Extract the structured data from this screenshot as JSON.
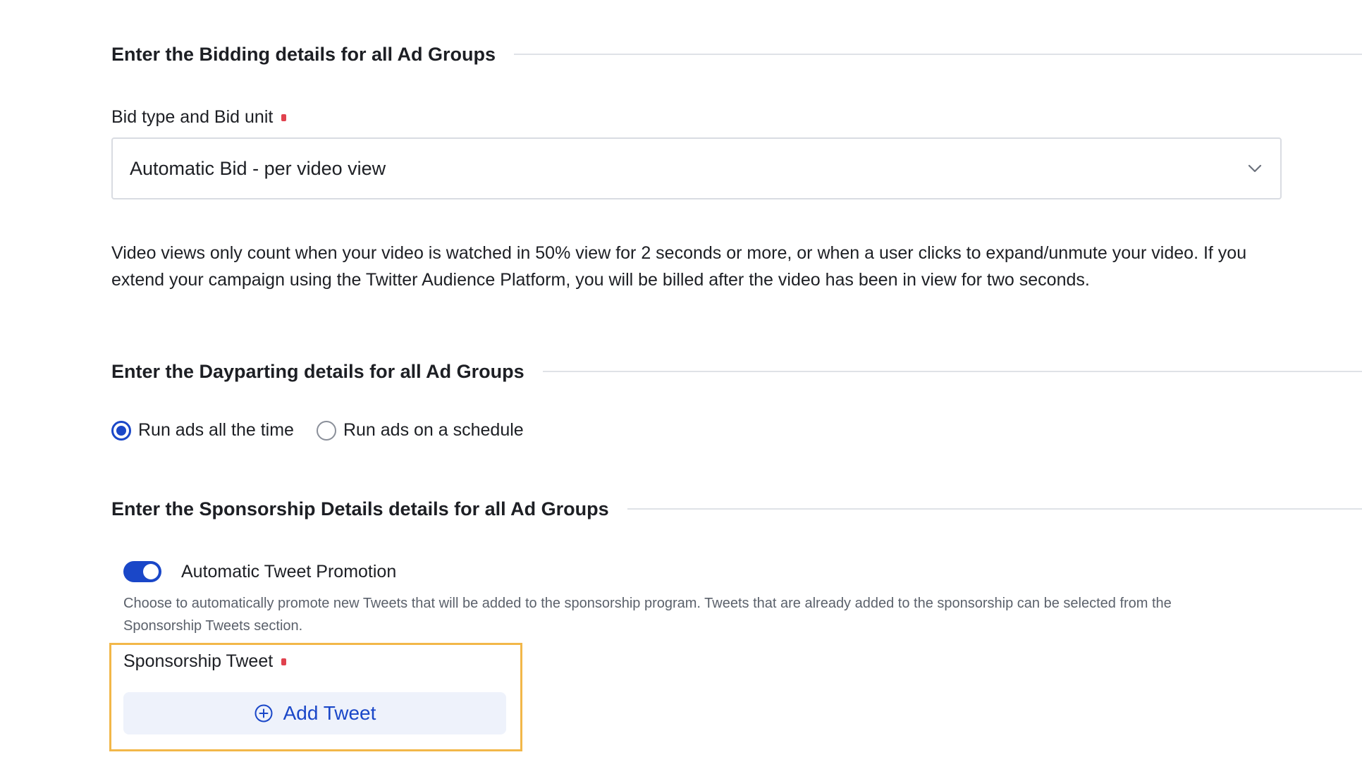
{
  "bidding": {
    "section_title": "Enter the Bidding details for all Ad Groups",
    "bid_label": "Bid type and Bid unit",
    "bid_value": "Automatic Bid - per video view",
    "help_text": "Video views only count when your video is watched in 50% view for 2 seconds or more, or when a user clicks to expand/unmute your video. If you extend your campaign using the Twitter Audience Platform, you will be billed after the video has been in view for two seconds."
  },
  "dayparting": {
    "section_title": "Enter the Dayparting details for all Ad Groups",
    "options": [
      {
        "label": "Run ads all the time",
        "selected": true
      },
      {
        "label": "Run ads on a schedule",
        "selected": false
      }
    ]
  },
  "sponsorship": {
    "section_title": "Enter the Sponsorship Details details for all Ad Groups",
    "toggle_label": "Automatic Tweet Promotion",
    "toggle_on": true,
    "toggle_description": "Choose to automatically promote new Tweets that will be added to the sponsorship program. Tweets that are already added to the sponsorship can be selected from the Sponsorship Tweets section.",
    "tweet_label": "Sponsorship Tweet",
    "add_tweet_label": "Add Tweet"
  },
  "colors": {
    "accent": "#1a47c8",
    "required": "#e0424e",
    "highlight": "#f2b749",
    "button_bg": "#eef2fb"
  },
  "icons": {
    "dropdown": "chevron-down-icon",
    "add": "plus-circle-icon"
  }
}
